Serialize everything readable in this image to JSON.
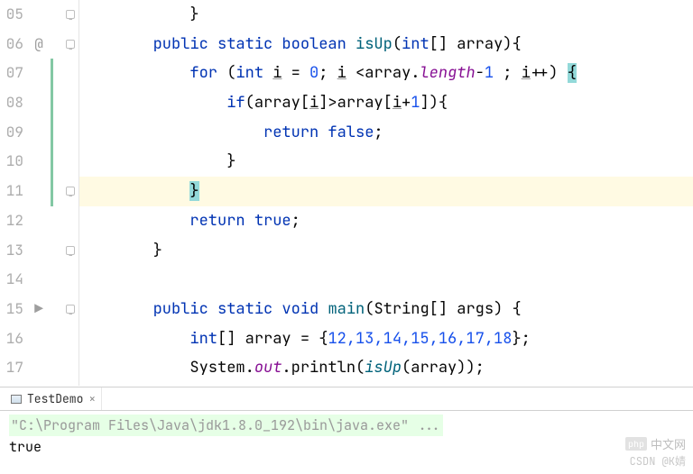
{
  "gutter": {
    "lines": [
      "05",
      "06",
      "07",
      "08",
      "09",
      "10",
      "11",
      "12",
      "13",
      "14",
      "15",
      "16",
      "17"
    ],
    "marks": [
      "",
      "@",
      "",
      "",
      "",
      "",
      "",
      "",
      "",
      "",
      "▶",
      "",
      ""
    ],
    "indicator_rows": [
      2,
      3,
      4,
      5,
      6
    ]
  },
  "code": {
    "l05": "            }",
    "l06": {
      "pre": "        ",
      "kw1": "public",
      "sp1": " ",
      "kw2": "static",
      "sp2": " ",
      "kw3": "boolean",
      "sp3": " ",
      "fn": "isUp",
      "open": "(",
      "kw4": "int",
      "brk": "[] ",
      "arg": "array",
      "close": "){"
    },
    "l07": {
      "pre": "            ",
      "kw": "for",
      "open": " (",
      "ty": "int",
      "sp": " ",
      "v": "i",
      "eq": " = ",
      "n0": "0",
      "semi": "; ",
      "v2": "i",
      "lt": " <",
      "arr": "array",
      "dot": ".",
      "len": "length",
      "m1": "-",
      "n1": "1",
      "sp2": " ; ",
      "v3": "i",
      "inc": "++",
      "close": ") ",
      "br": "{"
    },
    "l08": {
      "pre": "                ",
      "kw": "if",
      "open": "(",
      "arr": "array",
      "b1": "[",
      "i": "i",
      "b2": "]>",
      "arr2": "array",
      "b3": "[",
      "i2": "i",
      "plus": "+",
      "n1": "1",
      "b4": "]){"
    },
    "l09": {
      "pre": "                    ",
      "kw": "return",
      "sp": " ",
      "v": "false",
      "semi": ";"
    },
    "l10": "                }",
    "l11": {
      "pre": "            ",
      "br": "}"
    },
    "l12": {
      "pre": "            ",
      "kw": "return",
      "sp": " ",
      "v": "true",
      "semi": ";"
    },
    "l13": "        }",
    "l14": "",
    "l15": {
      "pre": "        ",
      "kw1": "public",
      "sp1": " ",
      "kw2": "static",
      "sp2": " ",
      "kw3": "void",
      "sp3": " ",
      "fn": "main",
      "open": "(",
      "ty": "String",
      "brk": "[] ",
      "arg": "args",
      "close": ") {"
    },
    "l16": {
      "pre": "            ",
      "ty": "int",
      "brk": "[] ",
      "v": "array",
      "eq": " = {",
      "n": "12,13,14,15,16,17,18",
      "close": "};"
    },
    "l17": {
      "pre": "            ",
      "cls": "System",
      "dot": ".",
      "out": "out",
      "dot2": ".",
      "m": "println",
      "open": "(",
      "fn": "isUp",
      "open2": "(",
      "arg": "array",
      "close": "));"
    }
  },
  "panel": {
    "tab_label": "TestDemo",
    "cmd": "\"C:\\Program Files\\Java\\jdk1.8.0_192\\bin\\java.exe\" ...",
    "out": "true"
  },
  "watermark": {
    "logo": "php",
    "text": "中文网"
  },
  "csdn": "CSDN @K婧"
}
